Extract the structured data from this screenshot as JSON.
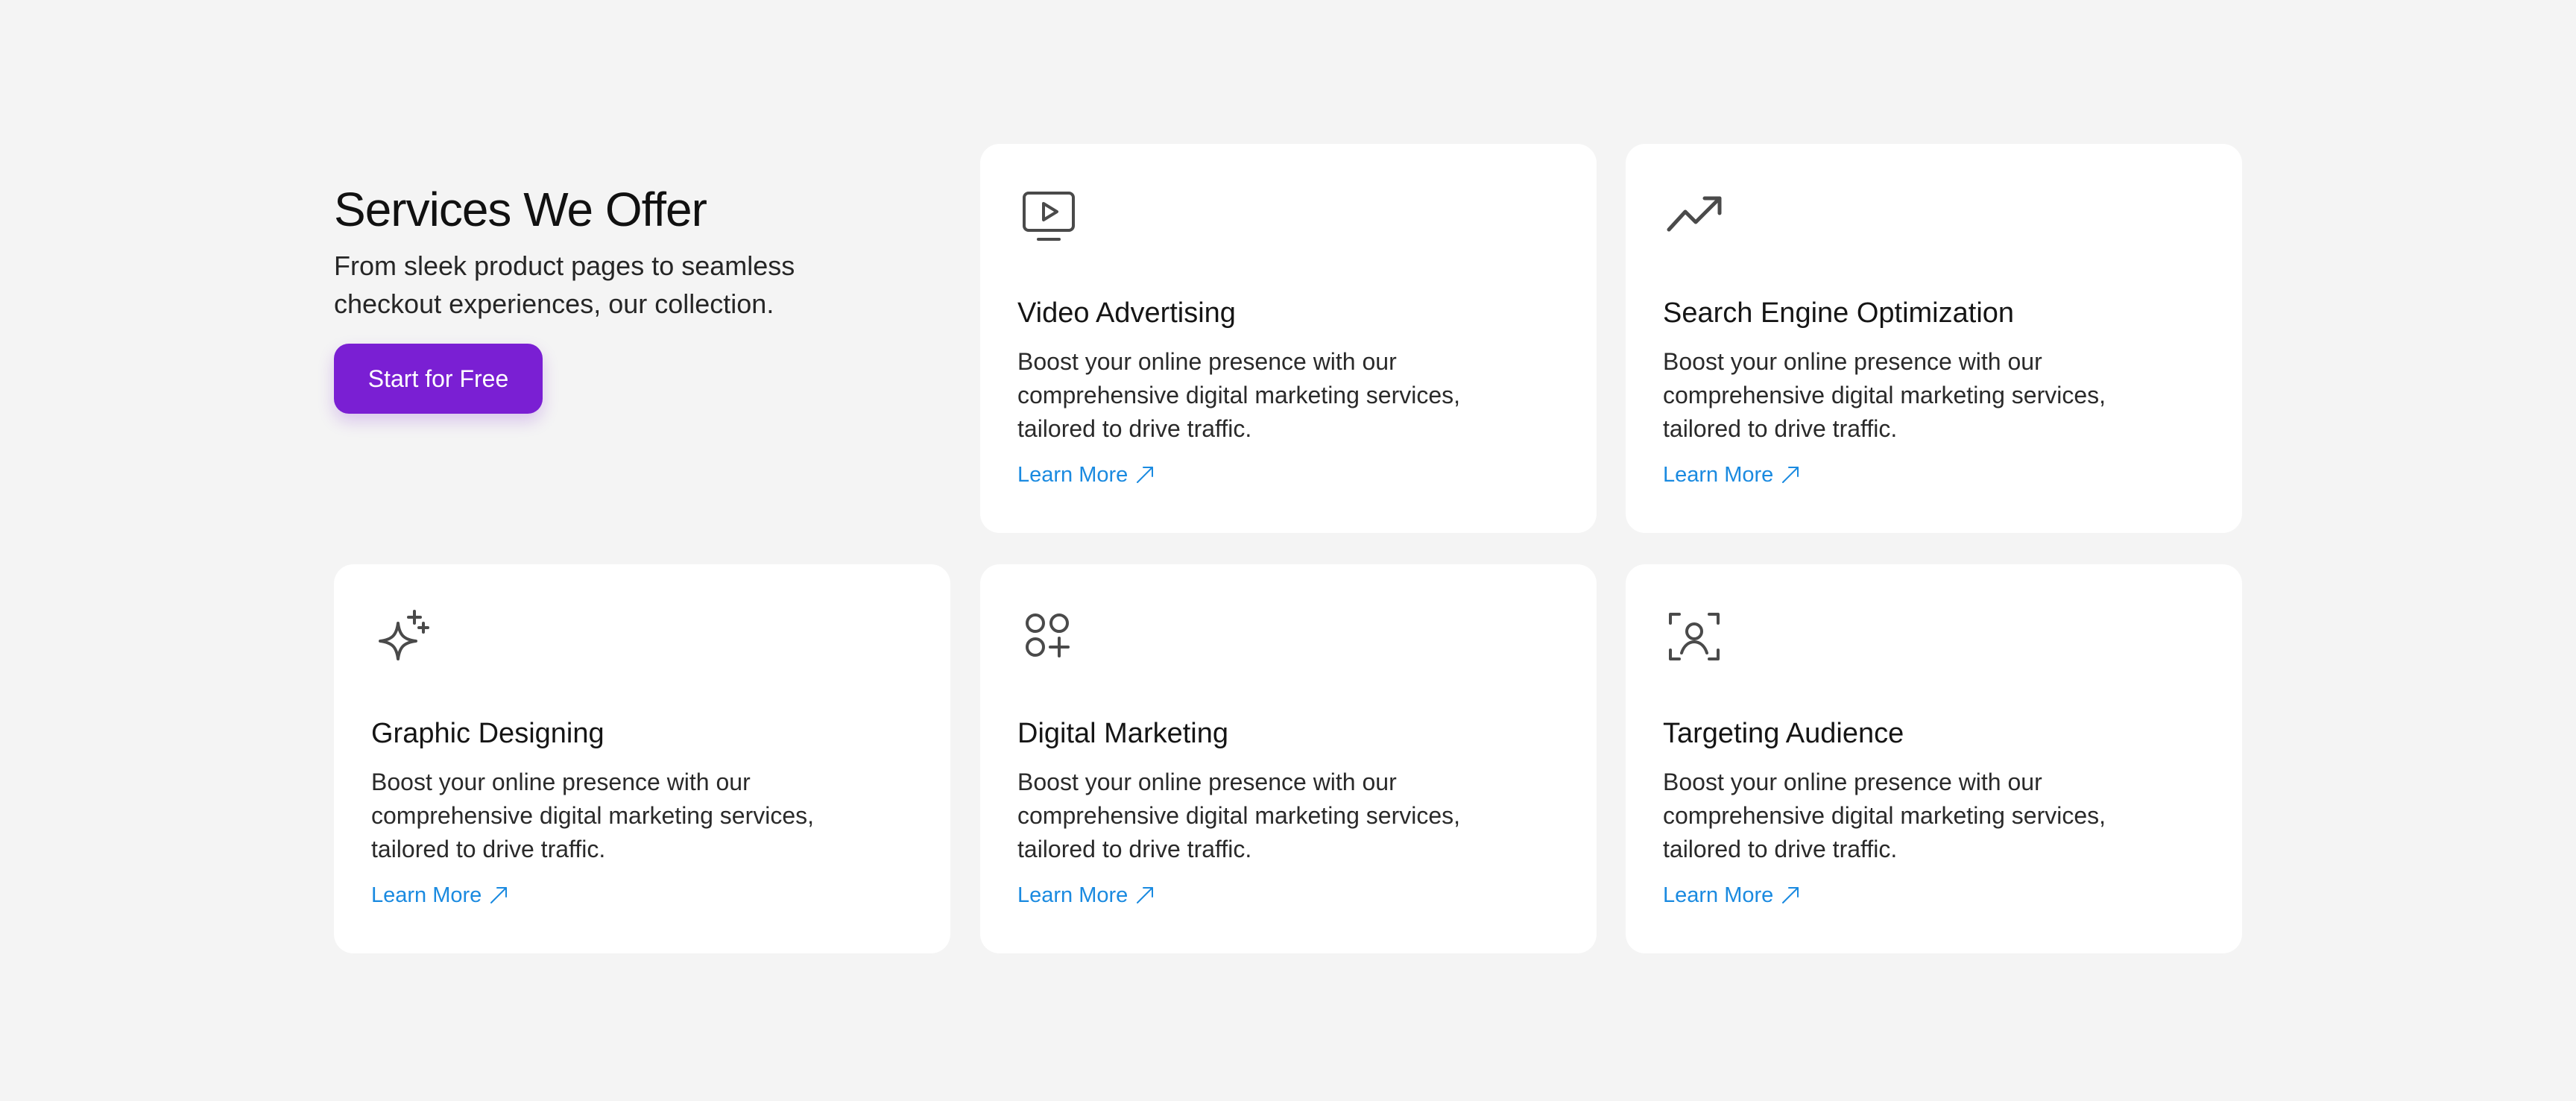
{
  "intro": {
    "title": "Services We Offer",
    "subtitle": "From sleek product pages to seamless checkout experiences, our collection.",
    "cta_label": "Start for Free"
  },
  "cards": [
    {
      "icon": "video-play-monitor-icon",
      "title": "Video Advertising",
      "description": "Boost your online presence with our comprehensive digital marketing services, tailored to drive traffic.",
      "link_label": "Learn More"
    },
    {
      "icon": "trending-up-icon",
      "title": "Search Engine Optimization",
      "description": "Boost your online presence with our comprehensive digital marketing services, tailored to drive traffic.",
      "link_label": "Learn More"
    },
    {
      "icon": "sparkles-icon",
      "title": "Graphic Designing",
      "description": "Boost your online presence with our comprehensive digital marketing services, tailored to drive traffic.",
      "link_label": "Learn More"
    },
    {
      "icon": "shapes-add-icon",
      "title": "Digital Marketing",
      "description": "Boost your online presence with our comprehensive digital marketing services, tailored to drive traffic.",
      "link_label": "Learn More"
    },
    {
      "icon": "user-focus-icon",
      "title": "Targeting Audience",
      "description": "Boost your online presence with our comprehensive digital marketing services, tailored to drive traffic.",
      "link_label": "Learn More"
    }
  ],
  "colors": {
    "background": "#f4f4f4",
    "card": "#ffffff",
    "accent": "#7a1fd3",
    "link": "#1a8ae0",
    "icon": "#4a4a4a"
  }
}
